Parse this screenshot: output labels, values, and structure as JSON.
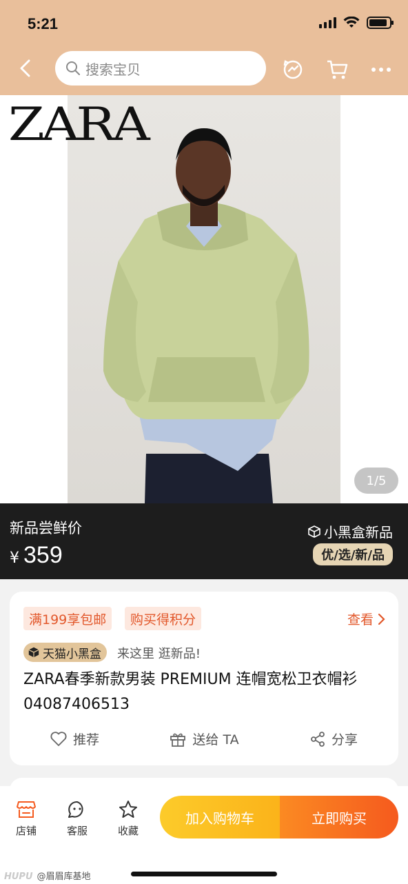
{
  "status": {
    "time": "5:21"
  },
  "search": {
    "placeholder": "搜索宝贝"
  },
  "gallery": {
    "brand_logo": "ZARA",
    "pager": "1/5"
  },
  "price": {
    "label": "新品尝鲜价",
    "currency": "¥",
    "value": "359",
    "channel": "小黑盒新品",
    "tag": "优/选/新/品"
  },
  "product": {
    "promo_tags": [
      "满199享包邮",
      "购买得积分"
    ],
    "view_more": "查看",
    "tmall_badge": "天猫小黑盒",
    "tmall_slogan": "来这里 逛新品!",
    "title": "ZARA春季新款男装 PREMIUM 连帽宽松卫衣帽衫 04087406513",
    "actions": {
      "recommend": "推荐",
      "gift": "送给 TA",
      "share": "分享"
    }
  },
  "bottom": {
    "store": "店铺",
    "service": "客服",
    "favorite": "收藏",
    "add_to_cart": "加入购物车",
    "buy_now": "立即购买"
  },
  "watermark": {
    "brand": "HUPU",
    "text": "@眉眉库基地"
  },
  "colors": {
    "header_bg": "#e9bf9b",
    "accent": "#e2572a",
    "cart_button": "#fbb31a",
    "buy_button": "#f55a1e",
    "price_band": "#1d1d1d"
  }
}
